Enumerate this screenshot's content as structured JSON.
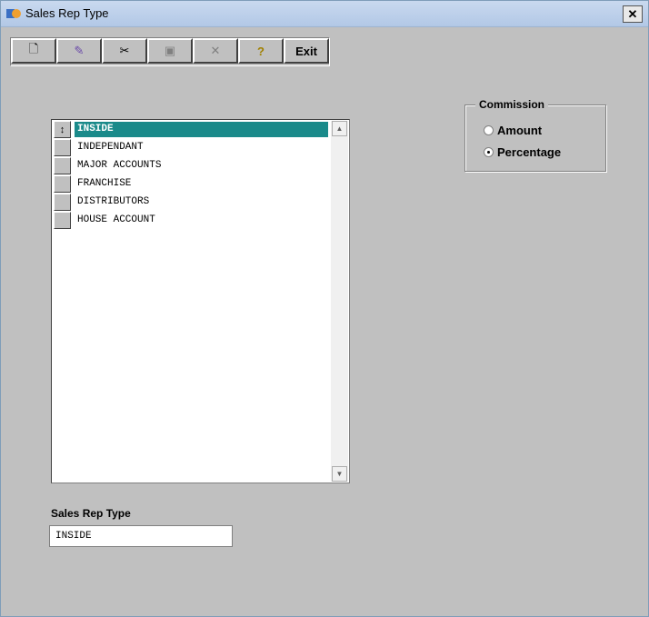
{
  "window": {
    "title": "Sales Rep Type",
    "close_label": "✕"
  },
  "toolbar": {
    "buttons": [
      {
        "name": "new",
        "icon": "new-document-icon",
        "glyph": "🗋"
      },
      {
        "name": "edit",
        "icon": "edit-icon",
        "glyph": "✎"
      },
      {
        "name": "cut",
        "icon": "scissors-icon",
        "glyph": "✂"
      },
      {
        "name": "save",
        "icon": "save-icon",
        "glyph": "▣"
      },
      {
        "name": "delete",
        "icon": "delete-x-icon",
        "glyph": "✕"
      },
      {
        "name": "help",
        "icon": "help-icon",
        "glyph": "?"
      }
    ],
    "exit_label": "Exit"
  },
  "list": {
    "items": [
      "INSIDE",
      "INDEPENDANT",
      "MAJOR ACCOUNTS",
      "FRANCHISE",
      "DISTRIBUTORS",
      "HOUSE ACCOUNT"
    ],
    "selected_index": 0,
    "selected_marker": "↕",
    "scroll_up": "▲",
    "scroll_down": "▼"
  },
  "commission": {
    "legend": "Commission",
    "options": [
      {
        "label": "Amount",
        "checked": false
      },
      {
        "label": "Percentage",
        "checked": true
      }
    ]
  },
  "field": {
    "label": "Sales Rep Type",
    "value": "INSIDE"
  },
  "colors": {
    "selection": "#1a8a8a",
    "background": "#c0c0c0",
    "titlebar": "#b2c8e6"
  }
}
